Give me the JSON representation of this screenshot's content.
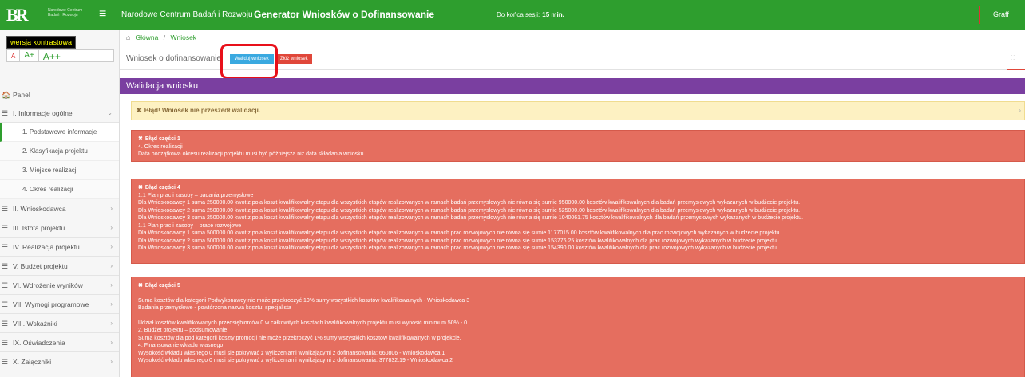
{
  "topbar": {
    "logo_mark": "BR",
    "logo_text": "Narodowe Centrum Badań i Rozwoju",
    "org_name": "Narodowe Centrum Badań i Rozwoju",
    "app_title": "Generator Wniosków o Dofinansowanie",
    "session_label": "Do końca sesji:",
    "session_value": "15 min.",
    "user": "Graff"
  },
  "sidebar": {
    "contrast_label": "wersja kontrastowa",
    "font_sizes": [
      "A",
      "A+",
      "A++"
    ],
    "panel_label": "Panel",
    "items": [
      {
        "label": "I. Informacje ogólne",
        "chev": "⌄"
      },
      {
        "label": "II. Wnioskodawca",
        "chev": "›"
      },
      {
        "label": "III. Istota projektu",
        "chev": "›"
      },
      {
        "label": "IV. Realizacja projektu",
        "chev": "›"
      },
      {
        "label": "V. Budżet projektu",
        "chev": "›"
      },
      {
        "label": "VI. Wdrożenie wyników",
        "chev": "›"
      },
      {
        "label": "VII. Wymogi programowe",
        "chev": "›"
      },
      {
        "label": "VIII. Wskaźniki",
        "chev": "›"
      },
      {
        "label": "IX. Oświadczenia",
        "chev": "›"
      },
      {
        "label": "X. Załączniki",
        "chev": "›"
      }
    ],
    "subitems": [
      "1. Podstawowe informacje",
      "2. Klasyfikacja projektu",
      "3. Miejsce realizacji",
      "4. Okres realizacji"
    ]
  },
  "breadcrumb": {
    "home": "Główna",
    "current": "Wniosek"
  },
  "header": {
    "title": "Wniosek o dofinansowanie",
    "validate_button": "Waliduj wniosek",
    "submit_button": "Złóż wniosek"
  },
  "validation": {
    "title": "Walidacja wniosku",
    "warning": "Błąd! Wniosek nie przeszedł walidacji.",
    "errors": [
      {
        "title": "Błąd części 1",
        "lines": [
          "4. Okres realizacji",
          "Data początkowa okresu realizacji projektu musi być późniejsza niż data składania wniosku."
        ]
      },
      {
        "title": "Błąd części 4",
        "lines": [
          "1.1 Plan prac i zasoby – badania przemysłowe",
          "Dla Wnioskodawcy 1 suma 250000.00 kwot z pola koszt kwalifikowalny etapu dla wszystkich etapów realizowanych w ramach badań przemysłowych nie równa się sumie 950000.00 kosztów kwalifikowalnych dla badań przemysłowych wykazanych w budżecie projektu.",
          "Dla Wnioskodawcy 2 suma 250000.00 kwot z pola koszt kwalifikowalny etapu dla wszystkich etapów realizowanych w ramach badań przemysłowych nie równa się sumie 525000.00 kosztów kwalifikowalnych dla badań przemysłowych wykazanych w budżecie projektu.",
          "Dla Wnioskodawcy 3 suma 250000.00 kwot z pola koszt kwalifikowalny etapu dla wszystkich etapów realizowanych w ramach badań przemysłowych nie równa się sumie 1040061.75 kosztów kwalifikowalnych dla badań przemysłowych wykazanych w budżecie projektu.",
          "1.1 Plan prac i zasoby – prace rozwojowe",
          "Dla Wnioskodawcy 1 suma 500000.00 kwot z pola koszt kwalifikowalny etapu dla wszystkich etapów realizowanych w ramach prac rozwojowych nie równa się sumie 1177015.00 kosztów kwalifikowalnych dla prac rozwojowych wykazanych w budżecie projektu.",
          "Dla Wnioskodawcy 2 suma 500000.00 kwot z pola koszt kwalifikowalny etapu dla wszystkich etapów realizowanych w ramach prac rozwojowych nie równa się sumie 153776.25 kosztów kwalifikowalnych dla prac rozwojowych wykazanych w budżecie projektu.",
          "Dla Wnioskodawcy 3 suma 500000.00 kwot z pola koszt kwalifikowalny etapu dla wszystkich etapów realizowanych w ramach prac rozwojowych nie równa się sumie 154390.00 kosztów kwalifikowalnych dla prac rozwojowych wykazanych w budżecie projektu."
        ]
      },
      {
        "title": "Błąd części 5",
        "lines": [
          "",
          "Suma kosztów dla kategorii Podwykonawcy nie może przekroczyć 10% sumy wszystkich kosztów kwalifikowalnych - Wnioskodawca 3",
          "Badania przemysłowe - powtórzona nazwa kosztu: specjalista",
          "",
          "Udział kosztów kwalifikowanych przedsiębiorców 0 w całkowitych kosztach kwalifikowalnych projektu musi wynosić minimum 50% - 0",
          "2. Budżet projektu – podsumowanie",
          "Suma kosztów dla pod kategorii koszty promocji nie może przekroczyć 1% sumy wszystkich kosztów kwalifikowalnych w projekcie.",
          "4. Finansowanie wkładu własnego",
          "Wysokość wkładu własnego 0 musi sie pokrywać z wyliczeniami wynikającymi z dofinansowania: 660806 - Wnioskodawca 1",
          "Wysokość wkładu własnego 0 musi sie pokrywać z wyliczeniami wynikającymi z dofinansowania: 377832.19 - Wnioskodawca 2"
        ]
      }
    ]
  }
}
